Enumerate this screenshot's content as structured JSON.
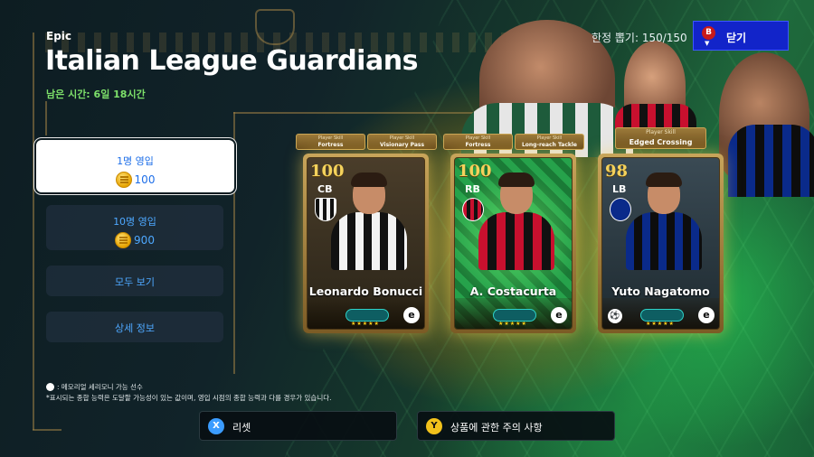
{
  "header": {
    "rarity": "Epic",
    "title": "Italian League Guardians",
    "time_left": "남은 시간: 6일 18시간",
    "limit": "한정 뽑기: 150/150",
    "close_button": {
      "key": "B",
      "label": "닫기"
    }
  },
  "menu": {
    "items": [
      {
        "label": "1명 영입",
        "price": "100",
        "selected": true
      },
      {
        "label": "10명 영입",
        "price": "900",
        "selected": false
      },
      {
        "label": "모두 보기"
      },
      {
        "label": "상세 정보"
      }
    ]
  },
  "cards": [
    {
      "rating": "100",
      "position": "CB",
      "name": "Leonardo Bonucci",
      "skills": [
        {
          "header": "Player Skill",
          "name": "Fortress"
        },
        {
          "header": "Player Skill",
          "name": "Visionary Pass"
        }
      ],
      "stars": "★★★★★",
      "logo": "e"
    },
    {
      "rating": "100",
      "position": "RB",
      "name": "A. Costacurta",
      "skills": [
        {
          "header": "Player Skill",
          "name": "Fortress"
        },
        {
          "header": "Player Skill",
          "name": "Long-reach Tackle"
        }
      ],
      "stars": "★★★★★",
      "logo": "e"
    },
    {
      "rating": "98",
      "position": "LB",
      "name": "Yuto Nagatomo",
      "skills": [
        {
          "header": "Player Skill",
          "name": "Edged Crossing"
        }
      ],
      "stars": "★★★★★",
      "logo": "e"
    }
  ],
  "notes": {
    "memorial": ": 메모리얼 세리모니 가능 선수",
    "disclaimer": "*표시되는 종합 능력은 도달할 가능성이 있는 값이며, 영입 시점의 종합 능력과 다를 경우가 있습니다."
  },
  "bottom_buttons": [
    {
      "key": "X",
      "label": "리셋",
      "key_color": "#3b9cff"
    },
    {
      "key": "Y",
      "label": "상품에 관한 주의 사항",
      "key_color": "#f2c21b"
    }
  ],
  "colors": {
    "accent_blue": "#1224c9",
    "time_green": "#7de06a",
    "menu_text_blue": "#4ea8ff"
  }
}
